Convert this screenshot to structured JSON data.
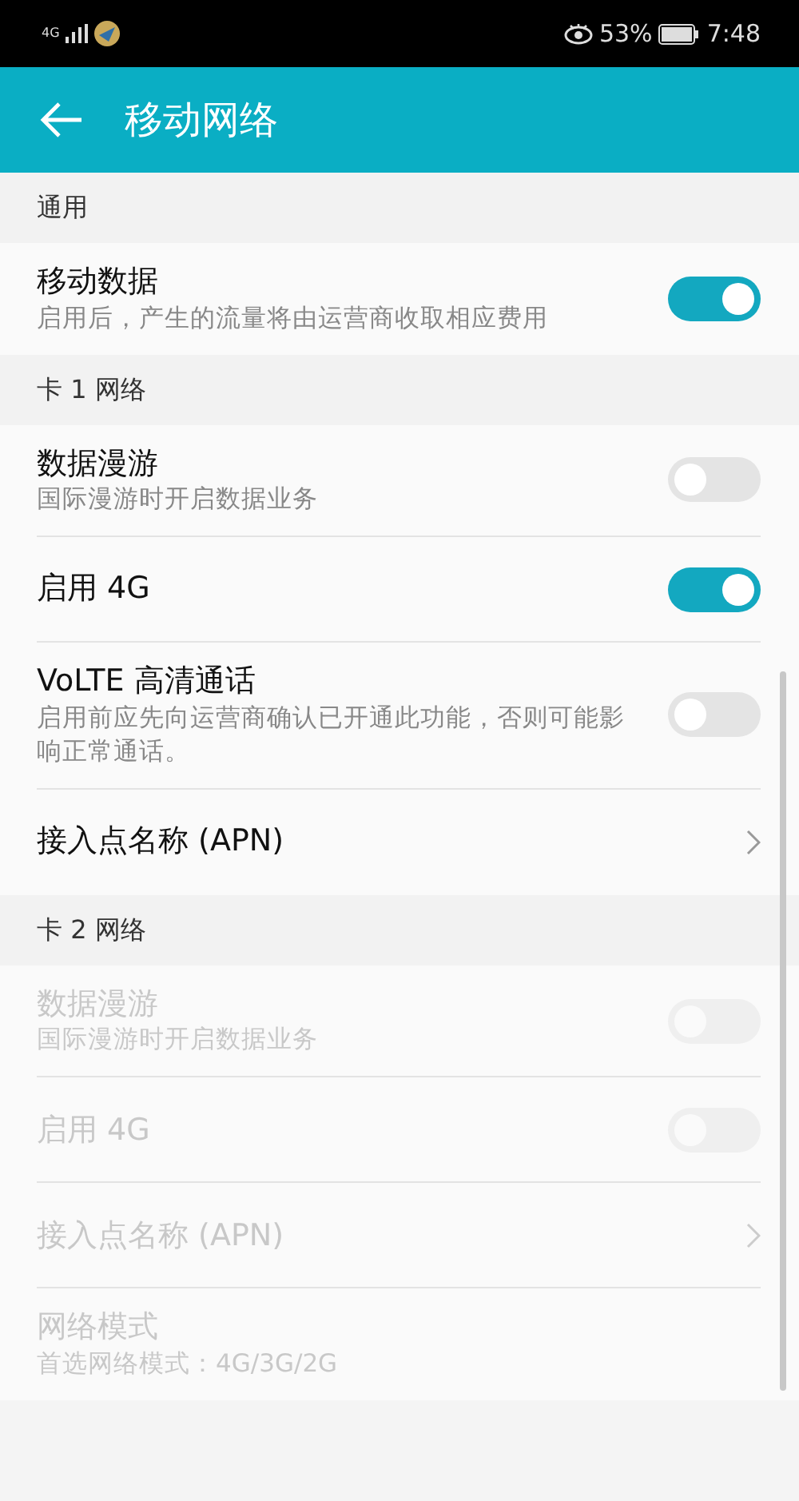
{
  "status_bar": {
    "network": "4G",
    "battery": "53%",
    "time": "7:48"
  },
  "app_bar": {
    "title": "移动网络"
  },
  "sections": [
    {
      "title": "通用",
      "items": [
        {
          "kind": "switch",
          "title": "移动数据",
          "subtitle": "启用后，产生的流量将由运营商收取相应费用",
          "on": true,
          "disabled": false
        }
      ]
    },
    {
      "title": "卡 1 网络",
      "items": [
        {
          "kind": "switch",
          "title": "数据漫游",
          "subtitle": "国际漫游时开启数据业务",
          "on": false,
          "disabled": false
        },
        {
          "kind": "switch",
          "title": "启用 4G",
          "on": true,
          "disabled": false
        },
        {
          "kind": "switch",
          "title": "VoLTE 高清通话",
          "subtitle": "启用前应先向运营商确认已开通此功能，否则可能影响正常通话。",
          "on": false,
          "disabled": false
        },
        {
          "kind": "link",
          "title": "接入点名称 (APN)",
          "disabled": false
        }
      ]
    },
    {
      "title": "卡 2 网络",
      "items": [
        {
          "kind": "switch",
          "title": "数据漫游",
          "subtitle": "国际漫游时开启数据业务",
          "on": false,
          "disabled": true
        },
        {
          "kind": "switch",
          "title": "启用 4G",
          "on": false,
          "disabled": true
        },
        {
          "kind": "link",
          "title": "接入点名称 (APN)",
          "disabled": true
        },
        {
          "kind": "text",
          "title": "网络模式",
          "subtitle": "首选网络模式：4G/3G/2G",
          "disabled": true
        }
      ]
    }
  ]
}
